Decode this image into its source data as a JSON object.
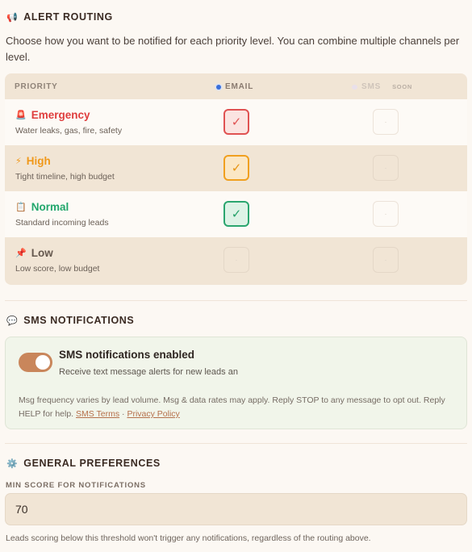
{
  "alert_routing": {
    "icon": "📢",
    "title": "ALERT ROUTING",
    "description": "Choose how you want to be notified for each priority level. You can combine multiple channels per level.",
    "columns": {
      "priority": "PRIORITY",
      "email": "EMAIL",
      "sms": "SMS",
      "sms_badge": "SOON"
    },
    "rows": [
      {
        "emoji": "🚨",
        "label": "Emergency",
        "sub": "Water leaks, gas, fire, safety",
        "email_mark": "✓",
        "sms_mark": "·",
        "color": "#df3d3d"
      },
      {
        "emoji": "⚡",
        "label": "High",
        "sub": "Tight timeline, high budget",
        "email_mark": "✓",
        "sms_mark": "·",
        "color": "#f0981a"
      },
      {
        "emoji": "📋",
        "label": "Normal",
        "sub": "Standard incoming leads",
        "email_mark": "✓",
        "sms_mark": "·",
        "color": "#22a76c"
      },
      {
        "emoji": "📌",
        "label": "Low",
        "sub": "Low score, low budget",
        "email_mark": "·",
        "sms_mark": "·",
        "color": "#65584e"
      }
    ]
  },
  "sms_notifications": {
    "icon": "💬",
    "title": "SMS NOTIFICATIONS",
    "toggle_state": "on",
    "toggle_label": "SMS notifications enabled",
    "toggle_sub": "Receive text message alerts for new leads and",
    "legal_text": "Msg frequency varies by lead volume. Msg & data rates may apply. Reply STOP to any message to opt out. Reply HELP for help.",
    "sms_terms": "SMS Terms",
    "separator": "·",
    "privacy": "Privacy Policy"
  },
  "general_preferences": {
    "icon": "⚙️",
    "title": "GENERAL PREFERENCES",
    "min_score_label": "MIN SCORE FOR NOTIFICATIONS",
    "min_score_value": "70",
    "help": "Leads scoring below this threshold won't trigger any notifications, regardless of the routing above."
  },
  "colors": {
    "accent": "#c9865b",
    "emergency": "#df3d3d",
    "high": "#f0981a",
    "normal": "#22a76c"
  }
}
